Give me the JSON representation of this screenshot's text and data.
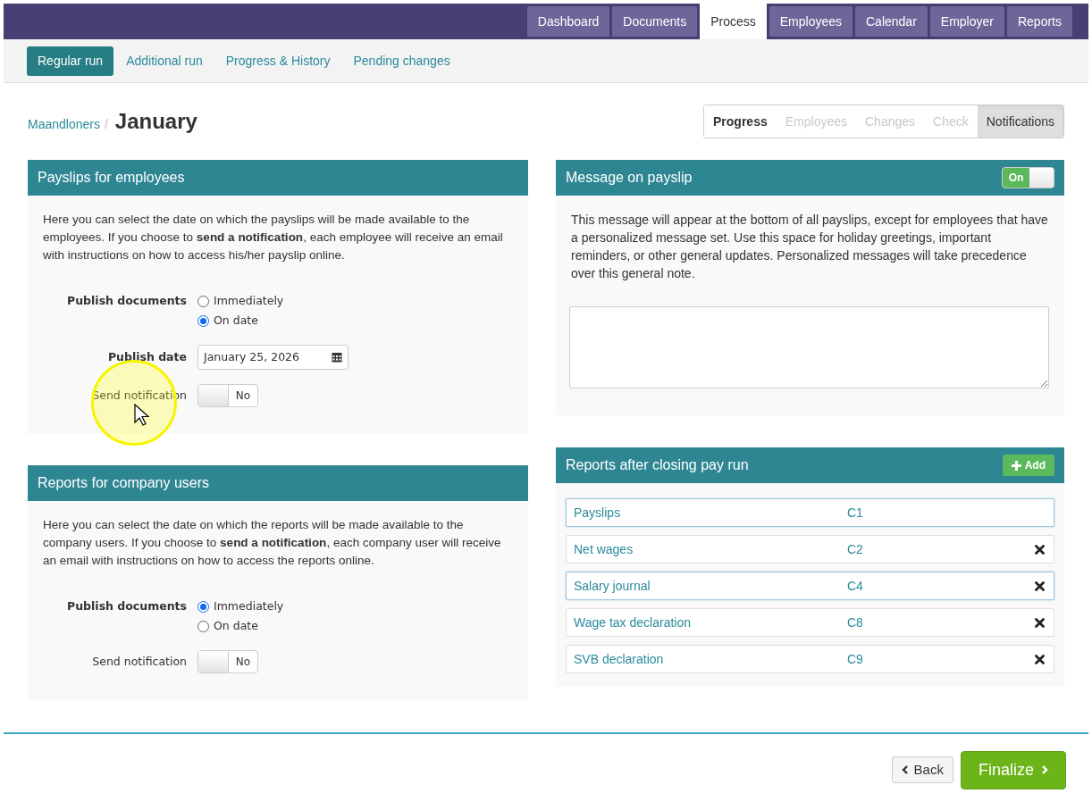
{
  "top_nav": {
    "tabs": [
      {
        "label": "Dashboard",
        "selected": false
      },
      {
        "label": "Documents",
        "selected": false
      },
      {
        "label": "Process",
        "selected": true
      },
      {
        "label": "Employees",
        "selected": false
      },
      {
        "label": "Calendar",
        "selected": false
      },
      {
        "label": "Employer",
        "selected": false
      },
      {
        "label": "Reports",
        "selected": false
      }
    ]
  },
  "sub_nav": {
    "items": [
      {
        "label": "Regular run",
        "selected": true
      },
      {
        "label": "Additional run",
        "selected": false
      },
      {
        "label": "Progress & History",
        "selected": false
      },
      {
        "label": "Pending changes",
        "selected": false
      }
    ]
  },
  "breadcrumb": {
    "parent": "Maandloners",
    "separator": "/",
    "current": "January"
  },
  "steps": [
    {
      "label": "Progress",
      "selected": false,
      "disabled": false
    },
    {
      "label": "Employees",
      "selected": false,
      "disabled": true
    },
    {
      "label": "Changes",
      "selected": false,
      "disabled": true
    },
    {
      "label": "Check",
      "selected": false,
      "disabled": true
    },
    {
      "label": "Notifications",
      "selected": true,
      "disabled": false
    }
  ],
  "payslips_panel": {
    "title": "Payslips for employees",
    "description": "Here you can select the date on which the payslips will be made available to the employees. If you choose to **send a notification**, each employee will receive an email with instructions on how to access his/her payslip online.",
    "publish_documents": {
      "label": "Publish documents",
      "options": [
        {
          "label": "Immediately",
          "selected": false
        },
        {
          "label": "On date",
          "selected": true
        }
      ]
    },
    "publish_date": {
      "label": "Publish date",
      "value": "January 25, 2026"
    },
    "send_notification": {
      "label": "Send notification",
      "on": false,
      "text": "No"
    }
  },
  "reports_users_panel": {
    "title": "Reports for company users",
    "description": "Here you can select the date on which the reports will be made available to the company users. If you choose to **send a notification**, each company user will receive an email with instructions on how to access the reports online.",
    "publish_documents": {
      "label": "Publish documents",
      "options": [
        {
          "label": "Immediately",
          "selected": true
        },
        {
          "label": "On date",
          "selected": false
        }
      ]
    },
    "send_notification": {
      "label": "Send notification",
      "on": false,
      "text": "No"
    }
  },
  "message_panel": {
    "title": "Message on payslip",
    "toggle": {
      "on": true,
      "text": "On"
    },
    "description": "This message will appear at the bottom of all payslips, except for employees that have a personalized message set. Use this space for holiday greetings, important reminders, or other general updates. Personalized messages will take precedence over this general note."
  },
  "reports_panel": {
    "title": "Reports after closing pay run",
    "add_button": "Add",
    "rows": [
      {
        "name": "Payslips",
        "code": "C1",
        "selected": true,
        "removable": false
      },
      {
        "name": "Net wages",
        "code": "C2",
        "selected": false,
        "removable": true
      },
      {
        "name": "Salary journal",
        "code": "C4",
        "selected": true,
        "removable": true
      },
      {
        "name": "Wage tax declaration",
        "code": "C8",
        "selected": false,
        "removable": true
      },
      {
        "name": "SVB declaration",
        "code": "C9",
        "selected": false,
        "removable": true
      }
    ]
  },
  "footer": {
    "back_button": "Back",
    "finalize_button": "Finalize"
  }
}
